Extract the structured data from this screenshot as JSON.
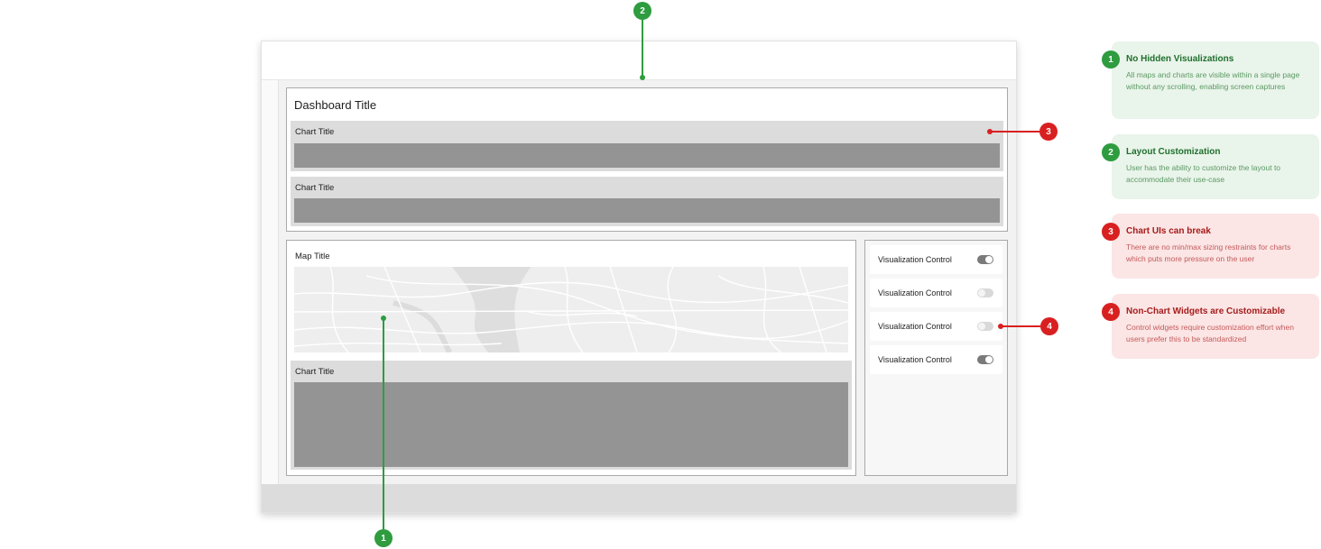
{
  "dashboard": {
    "title": "Dashboard Title",
    "charts": [
      {
        "title": "Chart Title"
      },
      {
        "title": "Chart Title"
      }
    ]
  },
  "map_panel": {
    "title": "Map Title",
    "chart_title": "Chart Title"
  },
  "controls": [
    {
      "label": "Visualization Control",
      "state": "on"
    },
    {
      "label": "Visualization Control",
      "state": "off"
    },
    {
      "label": "Visualization Control",
      "state": "off"
    },
    {
      "label": "Visualization Control",
      "state": "on"
    }
  ],
  "markers": [
    "1",
    "2",
    "3",
    "4"
  ],
  "notes": [
    {
      "number": "1",
      "kind": "positive",
      "title": "No Hidden Visualizations",
      "description": "All maps and charts are visible within a single page without any scrolling, enabling screen captures"
    },
    {
      "number": "2",
      "kind": "positive",
      "title": "Layout Customization",
      "description": "User has the ability to customize the layout to accommodate their use-case"
    },
    {
      "number": "3",
      "kind": "negative",
      "title": "Chart UIs can break",
      "description": "There are no min/max sizing restraints for charts which puts more pressure on the user"
    },
    {
      "number": "4",
      "kind": "negative",
      "title": "Non-Chart Widgets are Customizable",
      "description": "Control widgets require customization effort when users prefer this to be standardized"
    }
  ],
  "colors": {
    "positive": "#2e9c3f",
    "negative": "#d92020",
    "positive_bg": "#e9f4ea",
    "negative_bg": "#fbe5e5",
    "chart_fill": "#949494"
  }
}
